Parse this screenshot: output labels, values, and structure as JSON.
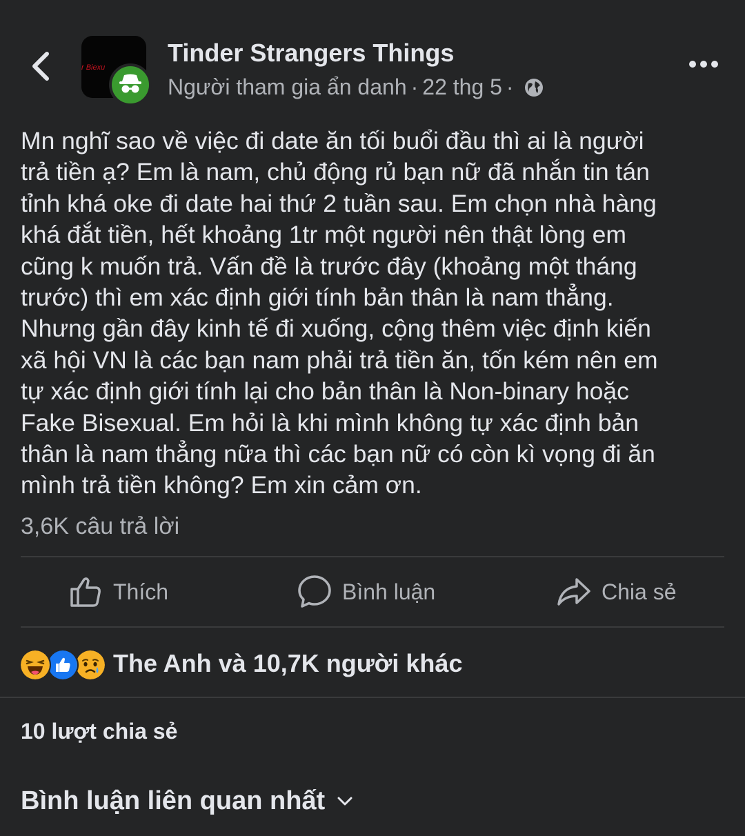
{
  "post": {
    "group_name": "Tinder Strangers Things",
    "avatar_text": "r Biexu",
    "author": "Người tham gia ẩn danh",
    "separator": "·",
    "date": "22 thg 5",
    "body": "Mn nghĩ sao về việc đi date ăn tối buổi đầu thì ai là người\ntrả tiền ạ? Em là nam, chủ động rủ bạn nữ đã nhắn tin tán\ntỉnh khá oke  đi date hai thứ 2 tuần sau. Em chọn nhà hàng\nkhá đắt tiền, hết khoảng 1tr một người nên thật lòng em\ncũng k muốn trả. Vấn đề là trước đây (khoảng một tháng\ntrước) thì em xác định giới tính bản thân là nam thẳng.\nNhưng gần đây kinh tế đi xuống, cộng thêm việc định kiến\nxã hội VN là các bạn nam phải trả tiền ăn, tốn kém nên em\ntự xác định giới tính lại cho bản thân là Non-binary hoặc\nFake Bisexual. Em hỏi là khi mình không tự xác định bản\nthân là nam thẳng nữa thì các bạn nữ có còn kì vọng đi ăn\nmình trả tiền không? Em xin cảm ơn.",
    "reply_count": "3,6K câu trả lời"
  },
  "actions": {
    "like": "Thích",
    "comment": "Bình luận",
    "share": "Chia sẻ"
  },
  "reactions": {
    "icons": [
      "haha-icon",
      "like-icon",
      "sad-icon"
    ],
    "summary": "The Anh và 10,7K người khác"
  },
  "shares": "10 lượt chia sẻ",
  "comments_sort": "Bình luận liên quan nhất",
  "colors": {
    "background": "#242526",
    "primary_text": "#e4e6eb",
    "secondary_text": "#b0b3b8",
    "divider": "#3a3b3c",
    "like_blue": "#1877f2",
    "anon_green": "#3a9a2f"
  }
}
